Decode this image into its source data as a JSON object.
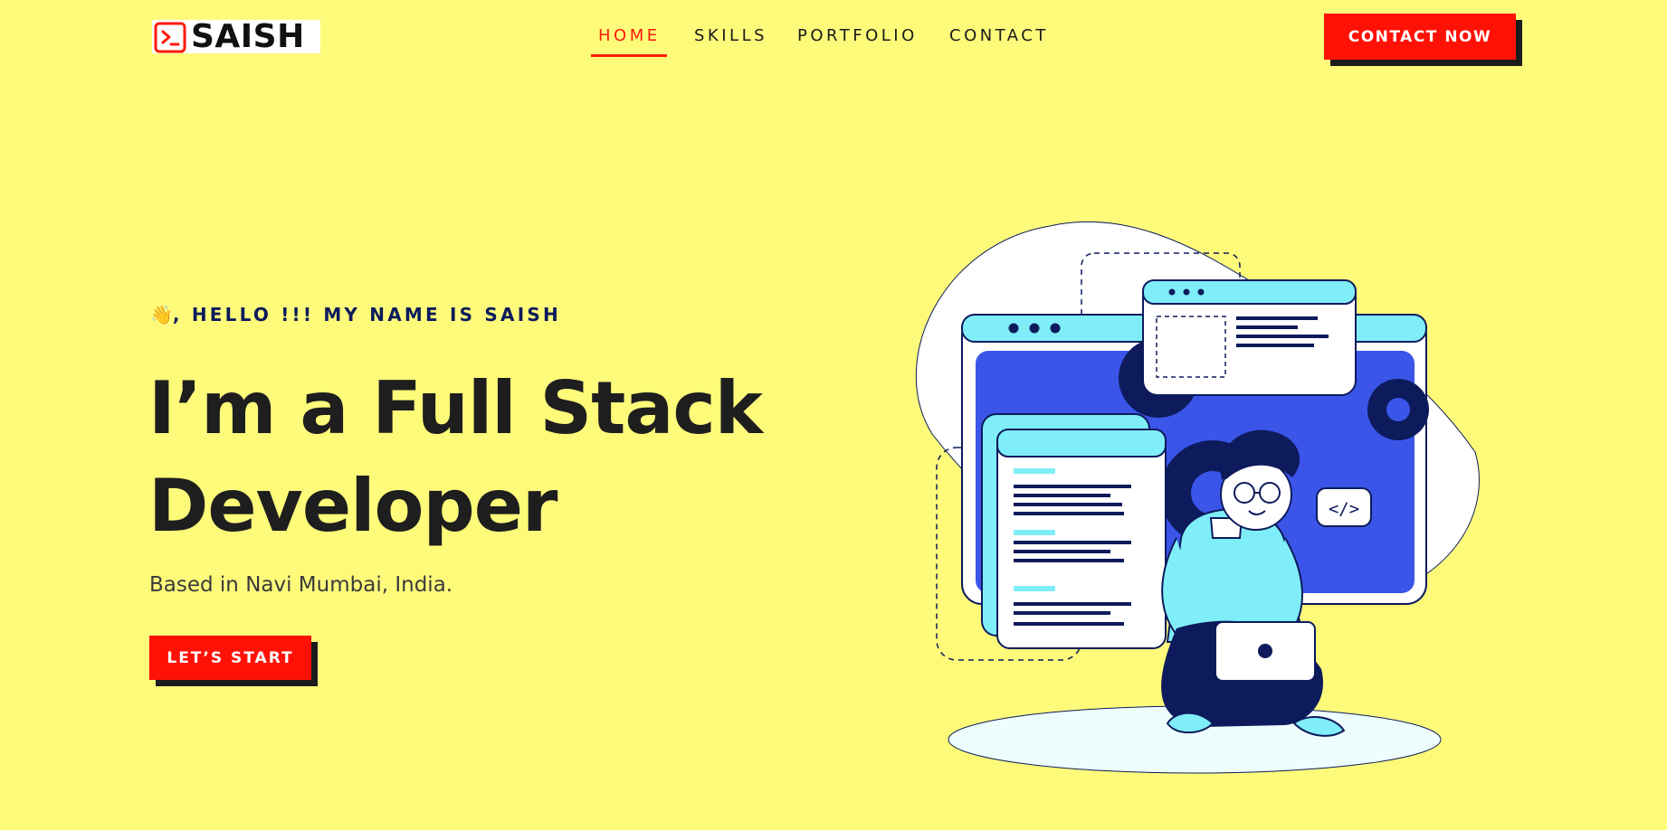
{
  "brand": {
    "logo_text": "SAISH",
    "logo_icon": "terminal-icon",
    "accent": "#fe1a0b",
    "background": "#fefb7b",
    "navy": "#0d1b5c"
  },
  "nav": {
    "items": [
      {
        "label": "HOME",
        "active": true
      },
      {
        "label": "SKILLS",
        "active": false
      },
      {
        "label": "PORTFOLIO",
        "active": false
      },
      {
        "label": "CONTACT",
        "active": false
      }
    ],
    "cta_label": "CONTACT NOW"
  },
  "hero": {
    "greeting_emoji": "👋",
    "greeting": ", HELLO !!! MY NAME IS SAISH",
    "headline_line1": "I’m a Full Stack",
    "headline_line2": "Developer",
    "subtitle": "Based in Navi Mumbai, India.",
    "cta_label": "LET’S START"
  },
  "illustration": {
    "code_badge": "</>",
    "icon": "developer-with-laptop-illustration"
  }
}
